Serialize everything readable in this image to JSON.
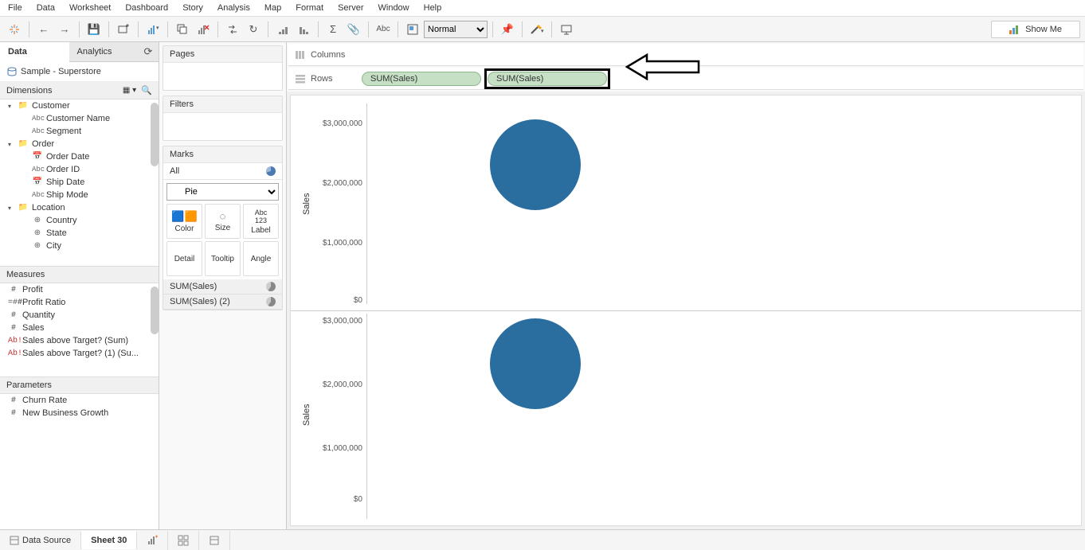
{
  "menu": [
    "File",
    "Data",
    "Worksheet",
    "Dashboard",
    "Story",
    "Analysis",
    "Map",
    "Format",
    "Server",
    "Window",
    "Help"
  ],
  "toolbar": {
    "fit_select": "Normal",
    "showme": "Show Me"
  },
  "side_tabs": {
    "data": "Data",
    "analytics": "Analytics"
  },
  "datasource": "Sample - Superstore",
  "sections": {
    "dimensions": "Dimensions",
    "measures": "Measures",
    "parameters": "Parameters"
  },
  "dims": {
    "customer_folder": "Customer",
    "customer_name": "Customer Name",
    "segment": "Segment",
    "order_folder": "Order",
    "order_date": "Order Date",
    "order_id": "Order ID",
    "ship_date": "Ship Date",
    "ship_mode": "Ship Mode",
    "location_folder": "Location",
    "country": "Country",
    "state": "State",
    "city": "City"
  },
  "meas": {
    "profit": "Profit",
    "profit_ratio": "Profit Ratio",
    "quantity": "Quantity",
    "sales": "Sales",
    "sat_sum": "Sales above Target? (Sum)",
    "sat_1": "Sales above Target? (1) (Su..."
  },
  "params": {
    "churn": "Churn Rate",
    "nbg": "New Business Growth"
  },
  "cards": {
    "pages": "Pages",
    "filters": "Filters",
    "marks": "Marks",
    "all": "All",
    "pie": "Pie",
    "color": "Color",
    "size": "Size",
    "label": "Label",
    "detail": "Detail",
    "tooltip": "Tooltip",
    "angle": "Angle",
    "sum_sales_1": "SUM(Sales)",
    "sum_sales_2": "SUM(Sales) (2)"
  },
  "shelves": {
    "columns": "Columns",
    "rows": "Rows",
    "pill1": "SUM(Sales)",
    "pill2": "SUM(Sales)"
  },
  "chart_data": [
    {
      "type": "pie",
      "ylabel": "Sales",
      "ylim": [
        0,
        3000000
      ],
      "ticks": [
        "$3,000,000",
        "$2,000,000",
        "$1,000,000",
        "$0"
      ],
      "series": [
        {
          "name": "Sales",
          "value": 2300000,
          "color": "#2a6ea0"
        }
      ]
    },
    {
      "type": "pie",
      "ylabel": "Sales",
      "ylim": [
        0,
        3000000
      ],
      "ticks": [
        "$3,000,000",
        "$2,000,000",
        "$1,000,000",
        "$0"
      ],
      "series": [
        {
          "name": "Sales",
          "value": 2300000,
          "color": "#2a6ea0"
        }
      ]
    }
  ],
  "bottom": {
    "datasource": "Data Source",
    "sheet": "Sheet 30"
  }
}
